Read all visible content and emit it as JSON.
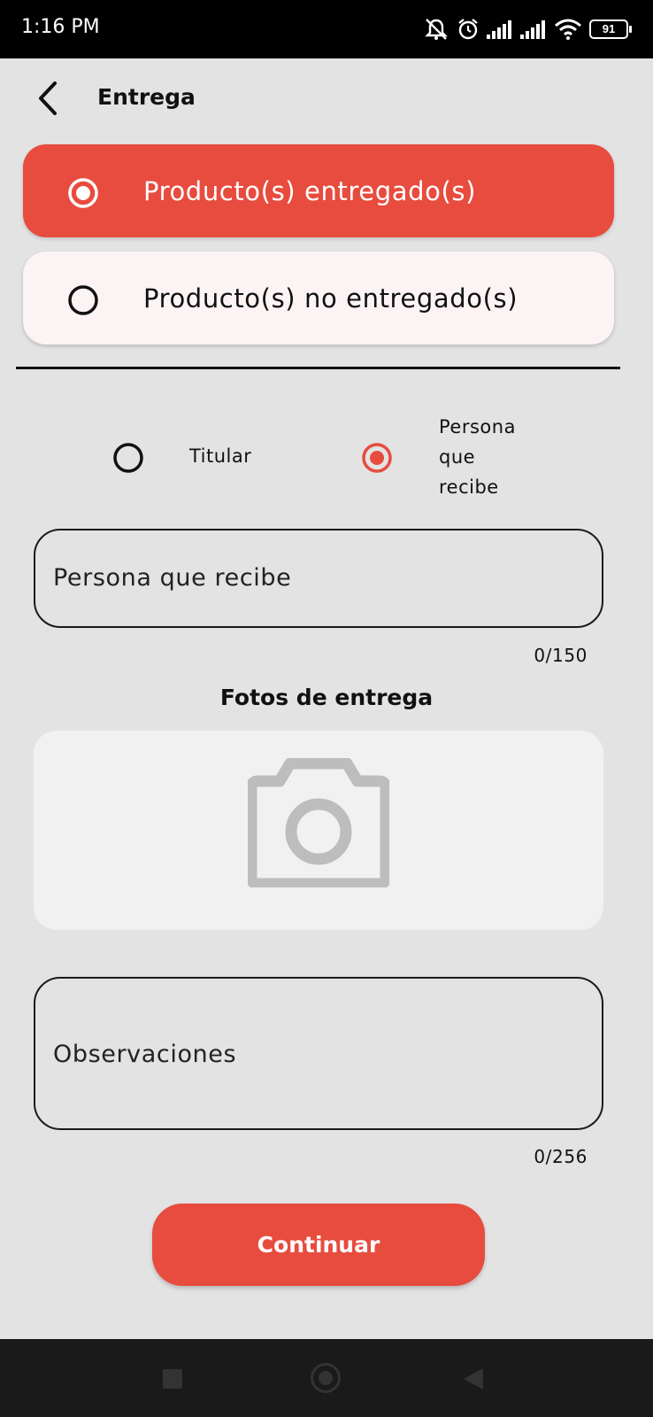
{
  "status_bar": {
    "time": "1:16 PM",
    "battery": "91",
    "icons": [
      "mute-icon",
      "alarm-icon",
      "signal-icon",
      "signal-icon",
      "wifi-icon",
      "battery-icon"
    ]
  },
  "header": {
    "title": "Entrega",
    "back_icon": "chevron-left-icon"
  },
  "delivery_options": [
    {
      "label": "Producto(s) entregado(s)",
      "selected": true
    },
    {
      "label": "Producto(s) no entregado(s)",
      "selected": false
    }
  ],
  "receiver_type": {
    "options": [
      {
        "label": "Titular",
        "selected": false
      },
      {
        "label": "Persona que recibe",
        "lines": [
          "Persona",
          "que",
          "recibe"
        ],
        "selected": true
      }
    ]
  },
  "receiver_field": {
    "placeholder": "Persona que recibe",
    "counter": "0/150"
  },
  "photos": {
    "title": "Fotos de entrega",
    "icon": "camera-icon"
  },
  "observations_field": {
    "placeholder": "Observaciones",
    "counter": "0/256"
  },
  "continue_button": {
    "label": "Continuar"
  },
  "colors": {
    "accent": "#e74c3e",
    "background": "#e3e3e3",
    "card_light": "#fcf4f4",
    "photo_box": "#f1f1f1"
  }
}
